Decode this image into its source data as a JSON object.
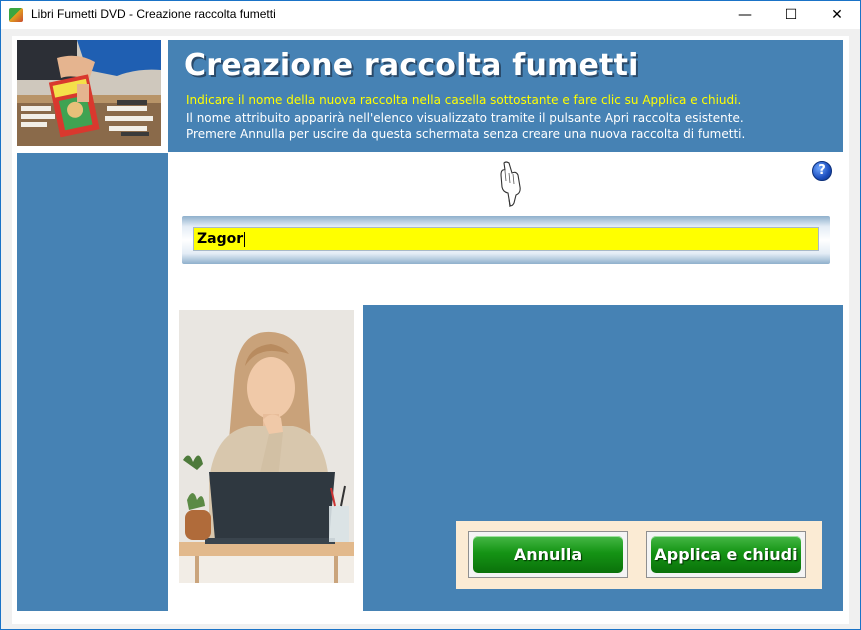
{
  "window": {
    "title": "Libri Fumetti DVD - Creazione raccolta fumetti",
    "minimize_glyph": "—",
    "maximize_glyph": "☐",
    "close_glyph": "✕"
  },
  "header": {
    "title": "Creazione raccolta fumetti",
    "line1": "Indicare il nome della nuova raccolta nella casella sottostante e fare clic su Applica e chiudi.",
    "line2": "Il nome attribuito apparirà nell'elenco visualizzato tramite il pulsante Apri raccolta esistente.",
    "line3": "Premere Annulla per uscire da questa schermata senza creare una nuova raccolta di fumetti."
  },
  "form": {
    "collection_name_value": "Zagor",
    "help_glyph": "?"
  },
  "buttons": {
    "cancel_label": "Annulla",
    "apply_label": "Applica e chiudi"
  },
  "colors": {
    "panel_blue": "#4682b4",
    "instruction_yellow": "#ffff00",
    "input_yellow": "#ffff00",
    "button_green": "#159415",
    "button_box": "#fbebd4"
  },
  "icons": [
    "app-icon",
    "pointing-hand-icon",
    "help-icon",
    "minimize-icon",
    "maximize-icon",
    "close-icon"
  ]
}
